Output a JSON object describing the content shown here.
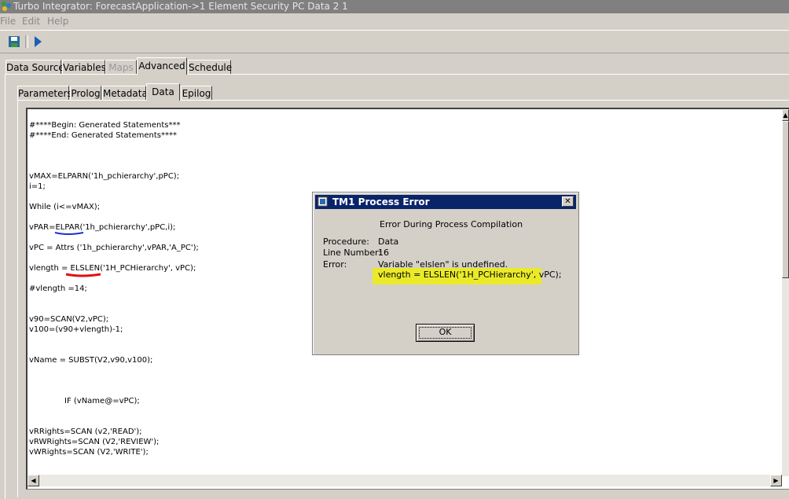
{
  "window": {
    "title": "Turbo Integrator: ForecastApplication->1 Element Security PC Data 2 1"
  },
  "menu": [
    {
      "label": "File"
    },
    {
      "label": "Edit"
    },
    {
      "label": "Help"
    }
  ],
  "toolbar": {
    "save_icon": "save-icon",
    "run_icon": "run-icon"
  },
  "main_tabs": [
    {
      "label": "Data Source"
    },
    {
      "label": "Variables"
    },
    {
      "label": "Maps"
    },
    {
      "label": "Advanced"
    },
    {
      "label": "Schedule"
    }
  ],
  "sub_tabs": [
    {
      "label": "Parameters"
    },
    {
      "label": "Prolog"
    },
    {
      "label": "Metadata"
    },
    {
      "label": "Data"
    },
    {
      "label": "Epilog"
    }
  ],
  "code": {
    "lines": [
      "#****Begin: Generated Statements***",
      "#****End: Generated Statements****",
      "vMAX=ELPARN('1h_pchierarchy',pPC);",
      "i=1;",
      "While (i<=vMAX);",
      "vPAR=ELPAR('1h_pchierarchy',pPC,i);",
      "vPC = Attrs ('1h_pchierarchy',vPAR,'A_PC');",
      "vlength = ELSLEN('1H_PCHierarchy', vPC);",
      "#vlength =14;",
      "v90=SCAN(V2,vPC);",
      "v100=(v90+vlength)-1;",
      "vName = SUBST(V2,v90,v100);",
      "IF (vName@=vPC);",
      "vRRights=SCAN (v2,'READ');",
      "vRWRights=SCAN (V2,'REVIEW');",
      "vWRights=SCAN (V2,'WRITE');"
    ]
  },
  "dialog": {
    "title": "TM1 Process Error",
    "heading": "Error During Process Compilation",
    "procedure_label": "Procedure:",
    "procedure_value": "Data",
    "line_label": "Line Number:",
    "line_value": "16",
    "error_label": "Error:",
    "error_message": "Variable \"elslen\" is undefined.",
    "error_statement": "vlength = ELSLEN('1H_PCHierarchy', vPC);",
    "ok_label": "OK",
    "highlight_color": "#eaea2a"
  },
  "colors": {
    "title_bar": "#808080",
    "dialog_title": "#0a246a",
    "underline_blue": "#1a2fd0",
    "underline_red": "#e01010"
  }
}
